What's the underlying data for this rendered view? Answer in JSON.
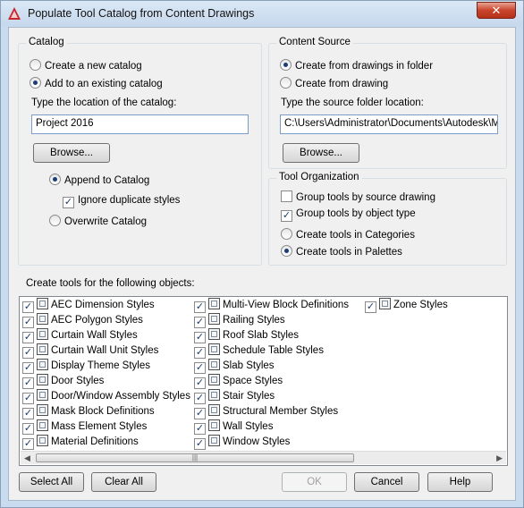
{
  "window": {
    "title": "Populate Tool Catalog from Content Drawings",
    "close_glyph": "✕",
    "accent": "#c9442c"
  },
  "catalog": {
    "group_title": "Catalog",
    "create_new": "Create a new catalog",
    "add_existing": "Add to an existing catalog",
    "location_label": "Type the location of the catalog:",
    "location_value": "Project 2016",
    "browse": "Browse...",
    "append": "Append to Catalog",
    "ignore_duplicates": "Ignore duplicate styles",
    "overwrite": "Overwrite Catalog"
  },
  "content_source": {
    "group_title": "Content Source",
    "from_folder": "Create from drawings in folder",
    "from_drawing": "Create from drawing",
    "folder_label": "Type the source folder location:",
    "folder_value": "C:\\Users\\Administrator\\Documents\\Autodesk\\My",
    "browse": "Browse..."
  },
  "tool_organization": {
    "group_title": "Tool Organization",
    "group_by_drawing": "Group tools by source drawing",
    "group_by_type": "Group tools by object type",
    "in_categories": "Create tools in Categories",
    "in_palettes": "Create tools in Palettes"
  },
  "objects": {
    "label": "Create tools for the following objects:",
    "col1": [
      {
        "label": "AEC Dimension Styles",
        "icon": "dimension-icon"
      },
      {
        "label": "AEC Polygon Styles",
        "icon": "polygon-icon"
      },
      {
        "label": "Curtain Wall Styles",
        "icon": "curtain-wall-icon"
      },
      {
        "label": "Curtain Wall Unit Styles",
        "icon": "curtain-wall-unit-icon"
      },
      {
        "label": "Display Theme Styles",
        "icon": "display-theme-icon"
      },
      {
        "label": "Door Styles",
        "icon": "door-icon"
      },
      {
        "label": "Door/Window Assembly Styles",
        "icon": "door-window-assembly-icon"
      },
      {
        "label": "Mask Block Definitions",
        "icon": "mask-block-icon"
      },
      {
        "label": "Mass Element Styles",
        "icon": "mass-element-icon"
      },
      {
        "label": "Material Definitions",
        "icon": "material-icon"
      }
    ],
    "col2": [
      {
        "label": "Multi-View Block Definitions",
        "icon": "multi-view-block-icon"
      },
      {
        "label": "Railing Styles",
        "icon": "railing-icon"
      },
      {
        "label": "Roof Slab Styles",
        "icon": "roof-slab-icon"
      },
      {
        "label": "Schedule Table Styles",
        "icon": "schedule-table-icon"
      },
      {
        "label": "Slab Styles",
        "icon": "slab-icon"
      },
      {
        "label": "Space Styles",
        "icon": "space-icon"
      },
      {
        "label": "Stair Styles",
        "icon": "stair-icon"
      },
      {
        "label": "Structural Member Styles",
        "icon": "structural-member-icon"
      },
      {
        "label": "Wall Styles",
        "icon": "wall-icon"
      },
      {
        "label": "Window Styles",
        "icon": "window-icon"
      }
    ],
    "col3": [
      {
        "label": "Zone Styles",
        "icon": "zone-icon"
      }
    ]
  },
  "buttons": {
    "select_all": "Select All",
    "clear_all": "Clear All",
    "ok": "OK",
    "cancel": "Cancel",
    "help": "Help"
  }
}
